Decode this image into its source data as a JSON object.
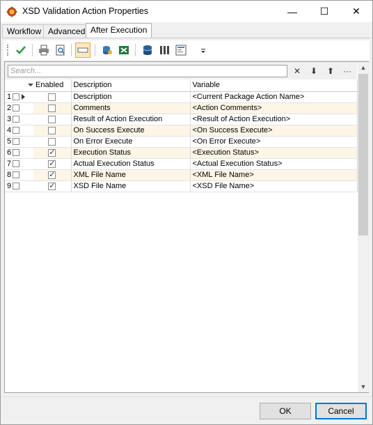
{
  "window": {
    "title": "XSD Validation Action Properties",
    "minimize_glyph": "—",
    "maximize_glyph": "☐",
    "close_glyph": "✕"
  },
  "tabs": [
    {
      "label": "Workflow",
      "active": false
    },
    {
      "label": "Advanced",
      "active": false
    },
    {
      "label": "After Execution",
      "active": true
    }
  ],
  "toolbar": {
    "icons": [
      "check-icon",
      "print-icon",
      "print-preview-icon",
      "toggle-view-icon",
      "database-user-icon",
      "excel-export-icon",
      "database-icon",
      "columns-icon",
      "report-icon",
      "overflow-dropdown-icon"
    ]
  },
  "search": {
    "placeholder": "Search...",
    "clear_glyph": "✕",
    "down_glyph": "⬇",
    "up_glyph": "⬆",
    "more_glyph": "···"
  },
  "grid": {
    "columns": [
      "",
      "Enabled",
      "Description",
      "Variable"
    ],
    "rows": [
      {
        "num": "1",
        "enabled": false,
        "description": "Description",
        "variable": "<Current Package Action Name>"
      },
      {
        "num": "2",
        "enabled": false,
        "description": "Comments",
        "variable": "<Action Comments>"
      },
      {
        "num": "3",
        "enabled": false,
        "description": "Result of Action Execution",
        "variable": "<Result of Action Execution>"
      },
      {
        "num": "4",
        "enabled": false,
        "description": "On Success Execute",
        "variable": "<On Success Execute>"
      },
      {
        "num": "5",
        "enabled": false,
        "description": "On Error Execute",
        "variable": "<On Error Execute>"
      },
      {
        "num": "6",
        "enabled": true,
        "description": "Execution Status",
        "variable": "<Execution Status>"
      },
      {
        "num": "7",
        "enabled": true,
        "description": "Actual Execution Status",
        "variable": "<Actual Execution Status>"
      },
      {
        "num": "8",
        "enabled": true,
        "description": "XML File Name",
        "variable": "<XML File Name>"
      },
      {
        "num": "9",
        "enabled": true,
        "description": "XSD File Name",
        "variable": "<XSD File Name>"
      }
    ]
  },
  "buttons": {
    "ok": "OK",
    "cancel": "Cancel"
  },
  "colors": {
    "alt_row": "#fdf5e6",
    "default_button_border": "#0078d7",
    "pressed_toolbar": "#fde9c0"
  }
}
